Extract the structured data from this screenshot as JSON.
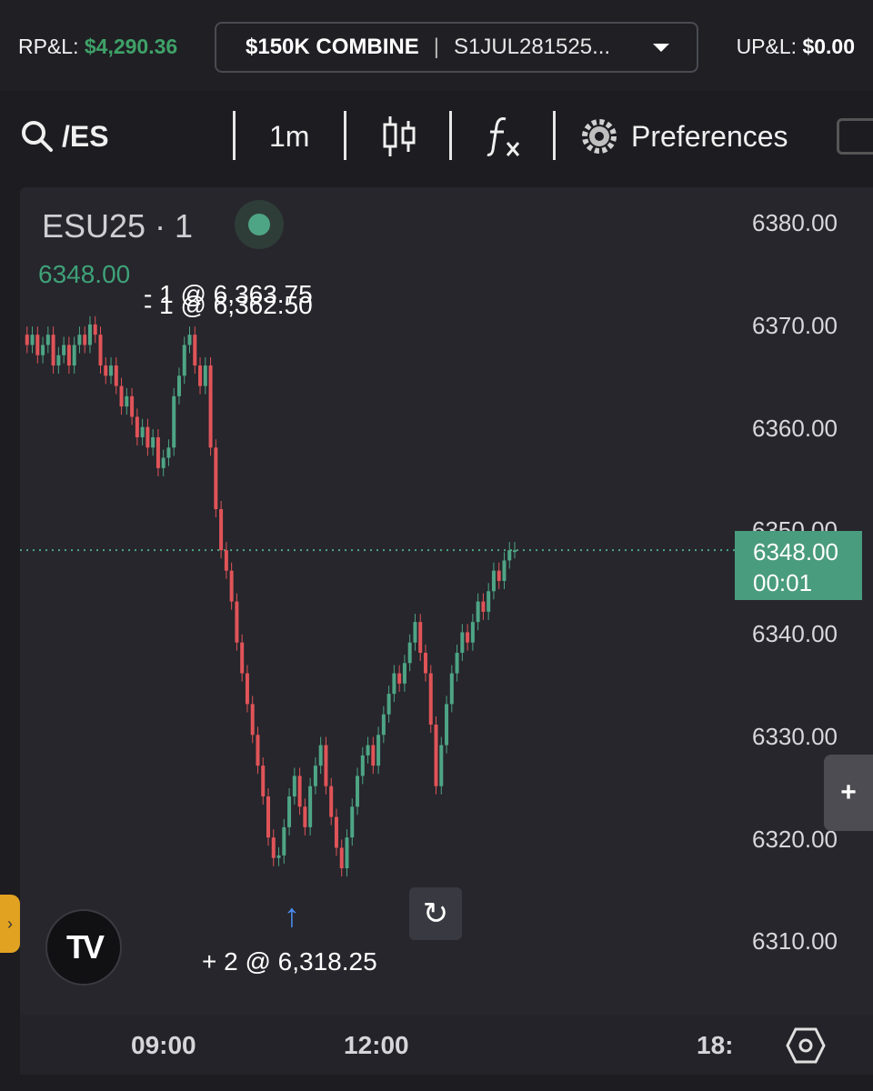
{
  "header": {
    "rpl_label": "RP&L:",
    "rpl_value": "$4,290.36",
    "account_plan": "$150K COMBINE",
    "account_separator": "|",
    "account_id": "S1JUL281525...",
    "upl_label": "UP&L:",
    "upl_value": "$0.00"
  },
  "toolbar": {
    "symbol": "/ES",
    "interval": "1m",
    "preferences": "Preferences"
  },
  "chart": {
    "symbol_title": "ESU25 · 1",
    "last_price": "6348.00",
    "price_tag_price": "6348.00",
    "price_tag_countdown": "00:01",
    "fill_sell_1": "- 1 @ 6,363.75",
    "fill_sell_2": "- 1 @ 6,362.50",
    "fill_buy": "+ 2 @ 6,318.25",
    "y_ticks": [
      "6380.00",
      "6370.00",
      "6360.00",
      "6350.00",
      "6340.00",
      "6330.00",
      "6320.00",
      "6310.00"
    ],
    "x_ticks": [
      "09:00",
      "12:00",
      "18:"
    ],
    "colors": {
      "up": "#4ea585",
      "down": "#e05458",
      "price_tag": "#4a9c7e"
    }
  },
  "chart_data": {
    "type": "line",
    "title": "",
    "ylim": [
      6305,
      6384
    ],
    "last": 6348.0,
    "series": [
      {
        "values": [
          6369,
          6368,
          6369,
          6367,
          6368,
          6369,
          6366,
          6367,
          6368,
          6366,
          6368,
          6369,
          6368,
          6370,
          6369,
          6366,
          6365,
          6366,
          6364,
          6362,
          6363,
          6361,
          6359,
          6360,
          6358,
          6359,
          6356,
          6357,
          6358,
          6363,
          6365,
          6368,
          6369,
          6366,
          6364,
          6366,
          6358,
          6352,
          6348,
          6346,
          6343,
          6339,
          6336,
          6333,
          6330,
          6327,
          6324,
          6320,
          6318,
          6318.25,
          6321,
          6324,
          6326,
          6323,
          6321,
          6325,
          6327,
          6329,
          6325,
          6322,
          6319,
          6317,
          6320,
          6323,
          6326,
          6328,
          6329,
          6327,
          6330,
          6332,
          6334,
          6336,
          6335,
          6337,
          6339,
          6341,
          6338,
          6336,
          6331,
          6325,
          6329,
          6333,
          6336,
          6338,
          6340,
          6339,
          6341,
          6343,
          6342,
          6344,
          6346,
          6345,
          6347,
          6348,
          6348
        ]
      }
    ]
  }
}
